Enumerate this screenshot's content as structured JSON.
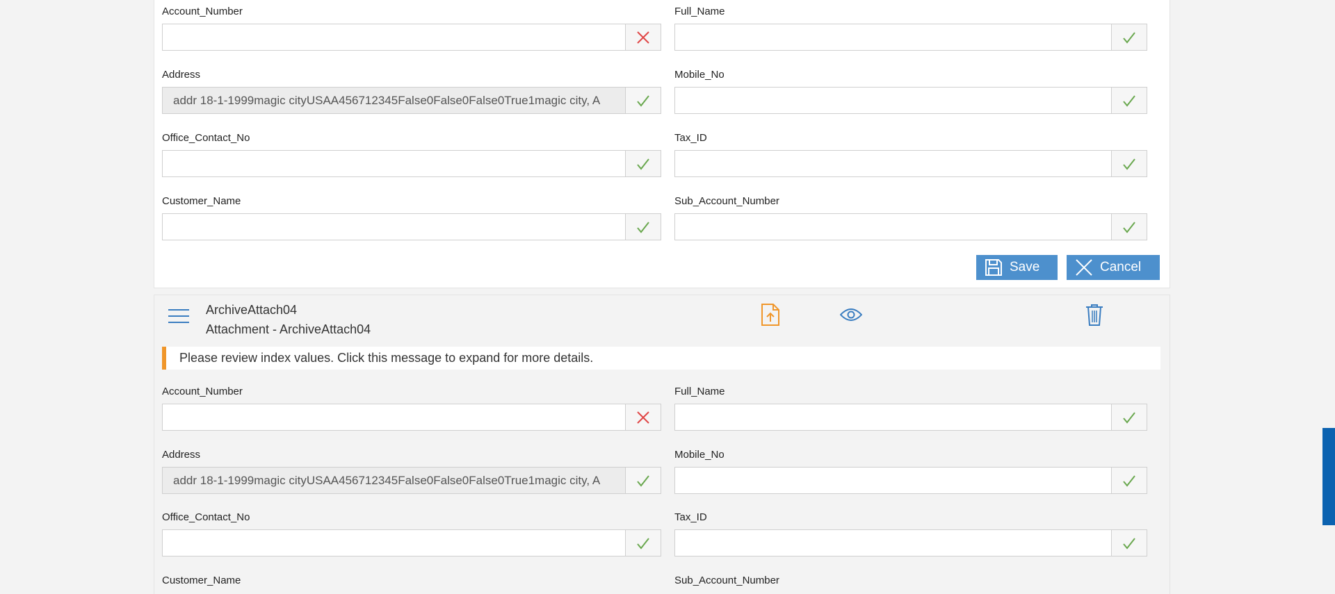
{
  "form_top": {
    "fields": [
      {
        "label": "Account_Number",
        "value": "",
        "status": "error"
      },
      {
        "label": "Full_Name",
        "value": "",
        "status": "ok"
      },
      {
        "label": "Address",
        "value": "addr 18-1-1999magic cityUSAA456712345False0False0False0True1magic city, A",
        "status": "ok"
      },
      {
        "label": "Mobile_No",
        "value": "",
        "status": "ok"
      },
      {
        "label": "Office_Contact_No",
        "value": "",
        "status": "ok"
      },
      {
        "label": "Tax_ID",
        "value": "",
        "status": "ok"
      },
      {
        "label": "Customer_Name",
        "value": "",
        "status": "ok"
      },
      {
        "label": "Sub_Account_Number",
        "value": "",
        "status": "ok"
      }
    ],
    "save_label": "Save",
    "cancel_label": "Cancel"
  },
  "attachment": {
    "name": "ArchiveAttach04",
    "subtitle": "Attachment - ArchiveAttach04",
    "icons": [
      "menu-icon",
      "upload-file-icon",
      "eye-icon",
      "trash-icon"
    ],
    "message": "Please review index values. Click this message to expand for more details."
  },
  "form_bottom": {
    "fields": [
      {
        "label": "Account_Number",
        "value": "",
        "status": "error"
      },
      {
        "label": "Full_Name",
        "value": "",
        "status": "ok"
      },
      {
        "label": "Address",
        "value": "addr 18-1-1999magic cityUSAA456712345False0False0False0True1magic city, A",
        "status": "ok"
      },
      {
        "label": "Mobile_No",
        "value": "",
        "status": "ok"
      },
      {
        "label": "Office_Contact_No",
        "value": "",
        "status": "ok"
      },
      {
        "label": "Tax_ID",
        "value": "",
        "status": "ok"
      },
      {
        "label": "Customer_Name",
        "value": "",
        "status": "ok"
      },
      {
        "label": "Sub_Account_Number",
        "value": "",
        "status": "ok"
      }
    ]
  },
  "colors": {
    "accent": "#4d90cd",
    "ok": "#6aa84f",
    "error": "#e04545",
    "warning": "#f0962a",
    "scrollbar": "#0b62b0"
  }
}
